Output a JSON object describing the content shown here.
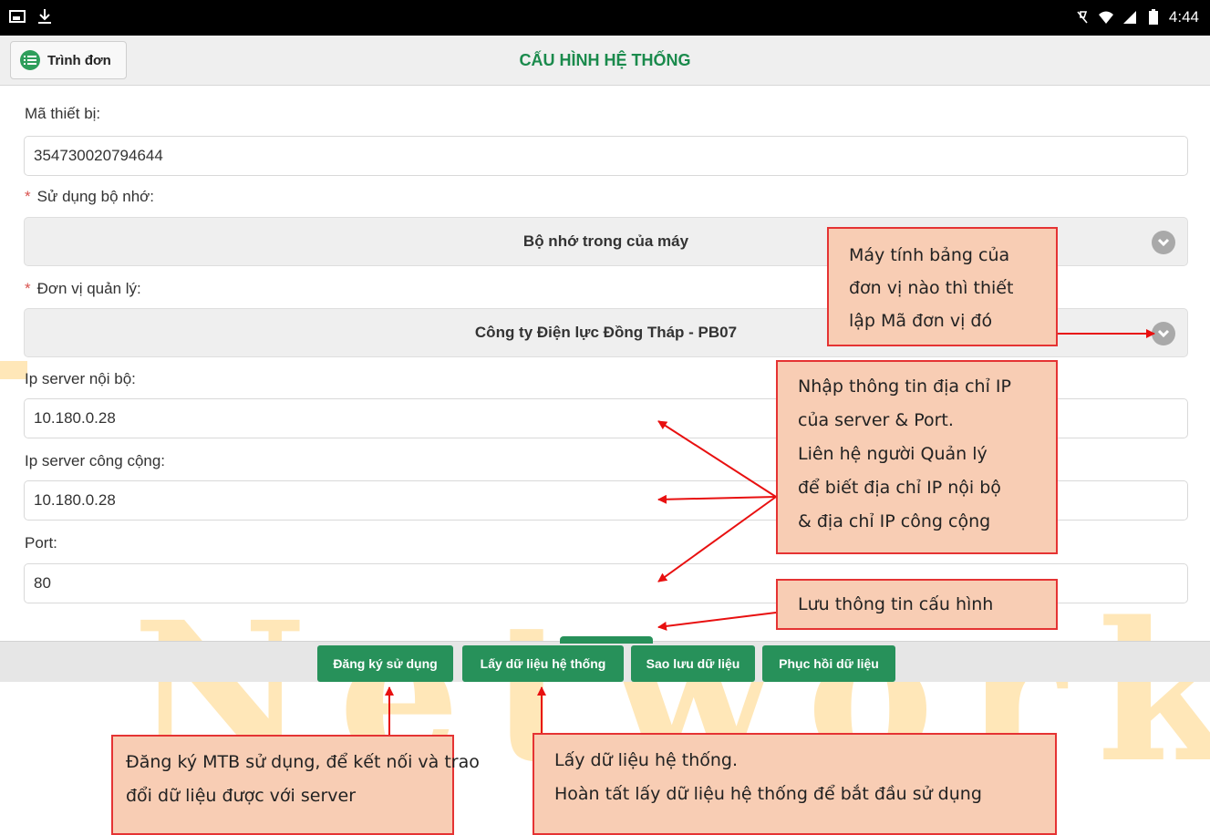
{
  "watermark": {
    "text": "Networks"
  },
  "status_bar": {
    "left_icons": [
      "screenshot-icon",
      "download-icon"
    ],
    "right_icons": [
      "mute-icon",
      "wifi-icon",
      "signal-icon",
      "battery-icon"
    ],
    "time": "4:44"
  },
  "header": {
    "menu_button_label": "Trình đơn",
    "title": "CẤU HÌNH HỆ THỐNG"
  },
  "form": {
    "device_id": {
      "label": "Mã thiết bị:",
      "value": "354730020794644"
    },
    "memory": {
      "required_mark": "*",
      "label": "Sử dụng bộ nhớ:",
      "selected": "Bộ nhớ trong của máy"
    },
    "unit": {
      "required_mark": "*",
      "label": "Đơn vị quản lý:",
      "selected": "Công ty Điện lực Đồng Tháp - PB07"
    },
    "ip_internal": {
      "label": "Ip server nội bộ:",
      "value": "10.180.0.28"
    },
    "ip_public": {
      "label": "Ip server công cộng:",
      "value": "10.180.0.28"
    },
    "port": {
      "label": "Port:",
      "value": "80"
    }
  },
  "buttons": {
    "register": "Đăng ký sử dụng",
    "fetch": "Lấy dữ liệu hệ thống",
    "backup": "Sao lưu dữ liệu",
    "restore": "Phục hồi dữ liệu"
  },
  "annotations": {
    "unit_note": [
      "Máy tính bảng của",
      "đơn vị nào thì thiết",
      "lập Mã đơn vị đó"
    ],
    "ip_note": [
      "Nhập thông tin địa chỉ IP",
      "của server & Port.",
      "Liên hệ người Quản lý",
      "để biết địa chỉ IP nội bộ",
      "& địa chỉ  IP công cộng"
    ],
    "save_note": [
      "Lưu thông tin cấu hình"
    ],
    "register_note": [
      "Đăng ký MTB sử dụng, để kết nối và trao",
      "đổi dữ liệu được với server"
    ],
    "fetch_note": [
      "Lấy dữ liệu hệ thống.",
      "Hoàn tất lấy dữ liệu hệ thống để bắt đầu sử dụng"
    ]
  },
  "colors": {
    "accent_green": "#27915a",
    "title_green": "#1a8a4c",
    "note_fill": "#f8cdb4",
    "note_border": "#e53333",
    "watermark": "#ffe7b8"
  }
}
